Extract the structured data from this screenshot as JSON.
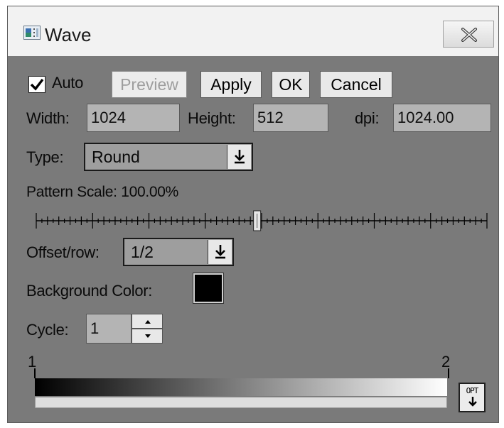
{
  "window": {
    "title": "Wave",
    "icon": "app-window-icon",
    "close_icon": "close-icon"
  },
  "toolbar": {
    "auto_label": "Auto",
    "auto_checked": true,
    "preview_label": "Preview",
    "apply_label": "Apply",
    "ok_label": "OK",
    "cancel_label": "Cancel"
  },
  "size": {
    "width_label": "Width:",
    "width_value": "1024",
    "height_label": "Height:",
    "height_value": "512",
    "dpi_label": "dpi:",
    "dpi_value": "1024.00"
  },
  "type": {
    "label": "Type:",
    "value": "Round"
  },
  "pattern_scale": {
    "label": "Pattern Scale: 100.00%",
    "slider_fraction": 0.49
  },
  "offset": {
    "label": "Offset/row:",
    "value": "1/2"
  },
  "background": {
    "label": "Background Color:",
    "color": "#000000"
  },
  "cycle": {
    "label": "Cycle:",
    "value": "1"
  },
  "gradient": {
    "start_label": "1",
    "end_label": "2",
    "start_color": "#000000",
    "end_color": "#ffffff",
    "opt_label": "OPT"
  }
}
